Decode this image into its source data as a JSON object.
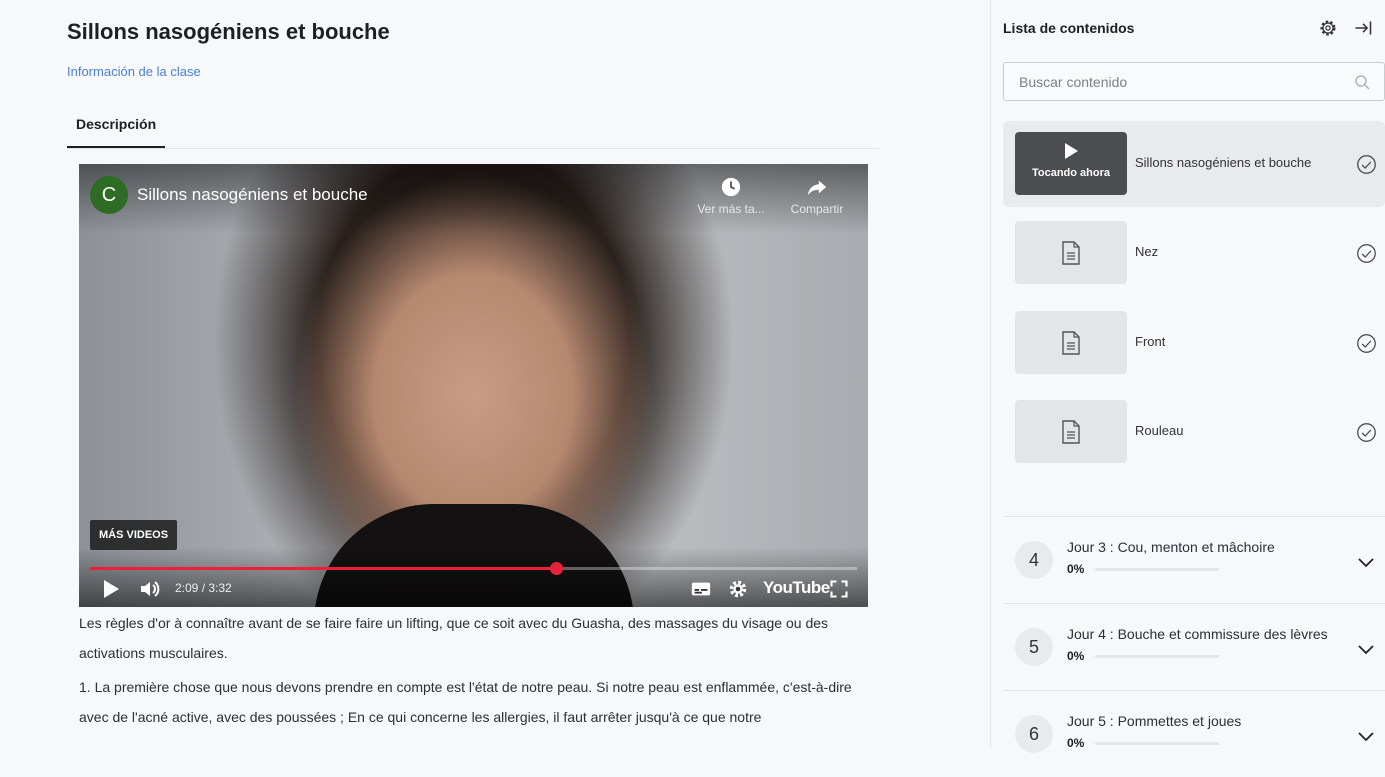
{
  "lesson": {
    "title": "Sillons nasogéniens et bouche",
    "info_link": "Información de la clase",
    "tab": "Descripción"
  },
  "video": {
    "channel_initial": "C",
    "title": "Sillons nasogéniens et bouche",
    "watch_later": "Ver más ta...",
    "share": "Compartir",
    "more_videos": "MÁS VIDEOS",
    "time": "2:09 / 3:32",
    "progress": 0.608,
    "logo": "YouTube"
  },
  "description": {
    "p1": "Les règles d'or à connaître avant de se faire faire un lifting, que ce soit avec du Guasha, des massages du visage ou des activations musculaires.",
    "p2": "1. La première chose que nous devons prendre en compte est l'état de notre peau. Si notre peau est enflammée, c'est-à-dire avec de l'acné active, avec des poussées ; En ce qui concerne les allergies, il faut arrêter jusqu'à ce que notre"
  },
  "sidebar": {
    "title": "Lista de contenidos",
    "search_placeholder": "Buscar contenido",
    "now_playing": "Tocando ahora",
    "lessons": [
      {
        "name": "Sillons nasogéniens et bouche",
        "active": true
      },
      {
        "name": "Nez"
      },
      {
        "name": "Front"
      },
      {
        "name": "Rouleau"
      }
    ],
    "days": [
      {
        "num": "4",
        "name": "Jour 3 : Cou, menton et mâchoire",
        "pct": "0%",
        "progress": 0
      },
      {
        "num": "5",
        "name": "Jour 4 : Bouche et commissure des lèvres",
        "pct": "0%",
        "progress": 0
      },
      {
        "num": "6",
        "name": "Jour 5 : Pommettes et joues",
        "pct": "0%",
        "progress": 0
      }
    ]
  }
}
